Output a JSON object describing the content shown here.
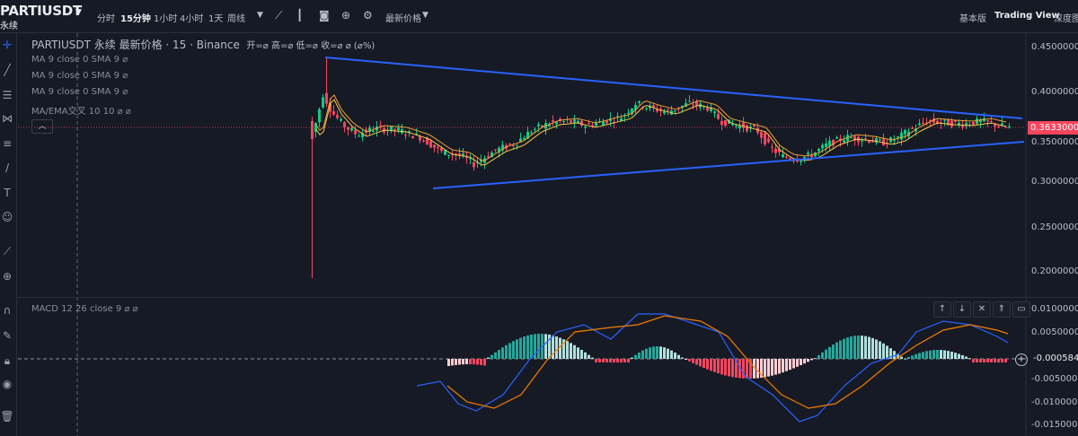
{
  "header": {
    "symbol": "PARTIUSDT",
    "perpetual": "永续",
    "intervals": [
      "分时",
      "15分钟",
      "1小时",
      "4小时",
      "1天",
      "周线"
    ],
    "active_interval": "15分钟",
    "price_type": "最新价格",
    "views": [
      "基本版",
      "Trading View",
      "深度图"
    ],
    "active_view": "Trading View"
  },
  "legend": {
    "title": "PARTIUSDT 永续 最新价格 · 15 · Binance",
    "ohlc": "开=⌀ 高=⌀ 低=⌀ 收=⌀ ⌀ (⌀%)",
    "ma1": "MA 9 close 0 SMA 9  ⌀",
    "ma2": "MA 9 close 0 SMA 9  ⌀",
    "ma3": "MA 9 close 0 SMA 9  ⌀",
    "ma_cross": "MA/EMA交叉  10 10  ⌀  ⌀",
    "macd": "MACD 12 26 close 9  ⌀  ⌀"
  },
  "price_axis": {
    "ticks": [
      "0.4500000",
      "0.4000000",
      "0.3500000",
      "0.3000000",
      "0.2500000",
      "0.2000000"
    ],
    "current_price": "0.3633000",
    "current_color": "#f6465d"
  },
  "macd_axis": {
    "ticks": [
      "0.0100000",
      "0.0050000",
      "-0.0050000",
      "-0.0100000",
      "-0.0150000"
    ],
    "current_value": "-0.000584"
  },
  "macd_controls": [
    "↑",
    "↓",
    "✕",
    "⇑",
    "▭"
  ],
  "colors": {
    "up": "#0ecb81",
    "down": "#f6465d",
    "trendline": "#2962ff",
    "ma_orange": "#f0a037",
    "background": "#161a25"
  },
  "tools": [
    "crosshair-icon",
    "trendline-icon",
    "horizontal-line-icon",
    "fib-icon",
    "pattern-icon",
    "brush-icon",
    "text-icon",
    "emoji-icon",
    "ruler-icon",
    "zoom-icon",
    "magnet-icon",
    "lock-draw-icon",
    "lock-icon",
    "eye-icon",
    "trash-icon"
  ]
}
